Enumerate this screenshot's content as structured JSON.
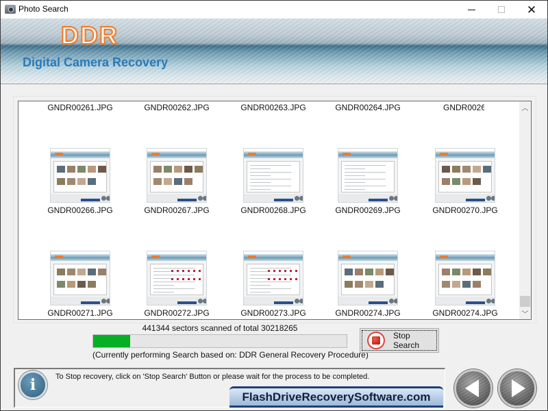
{
  "window": {
    "title": "Photo Search",
    "controls": {
      "minimize": "minimize",
      "maximize": "maximize",
      "close": "close"
    }
  },
  "banner": {
    "logo": "DDR",
    "subtitle": "Digital Camera Recovery"
  },
  "results": {
    "rows": [
      {
        "names": [
          "GNDR00261.JPG",
          "GNDR00262.JPG",
          "GNDR00263.JPG",
          "GNDR00264.JPG",
          "GNDR0026"
        ],
        "thumbnails_visible": false
      },
      {
        "names": [
          "GNDR00266.JPG",
          "GNDR00267.JPG",
          "GNDR00268.JPG",
          "GNDR00269.JPG",
          "GNDR00270.JPG"
        ],
        "thumbnails_visible": true
      },
      {
        "names": [
          "GNDR00271.JPG",
          "GNDR00272.JPG",
          "GNDR00273.JPG",
          "GNDR00274.JPG",
          "GNDR00274.JPG"
        ],
        "thumbnails_visible": true
      }
    ],
    "scroll_position_fraction": 0.95
  },
  "progress": {
    "sectors_scanned": 441344,
    "sectors_total": 30218265,
    "status_text": "441344 sectors scanned of total 30218265",
    "bar_fraction": 0.145,
    "procedure_text": "(Currently performing Search based on:  DDR General Recovery Procedure)",
    "fill_color": "#06b025"
  },
  "stop_button": {
    "label": "Stop Search"
  },
  "info": {
    "message": "To Stop recovery, click on 'Stop Search' Button or please wait for the process to be completed.",
    "brand": "FlashDriveRecoverySoftware.com"
  },
  "navigation": {
    "back": "back",
    "next": "next"
  },
  "colors": {
    "logo_orange": "#f07a2a",
    "subtitle_blue": "#2a7ab8",
    "stop_red": "#d9463a"
  }
}
